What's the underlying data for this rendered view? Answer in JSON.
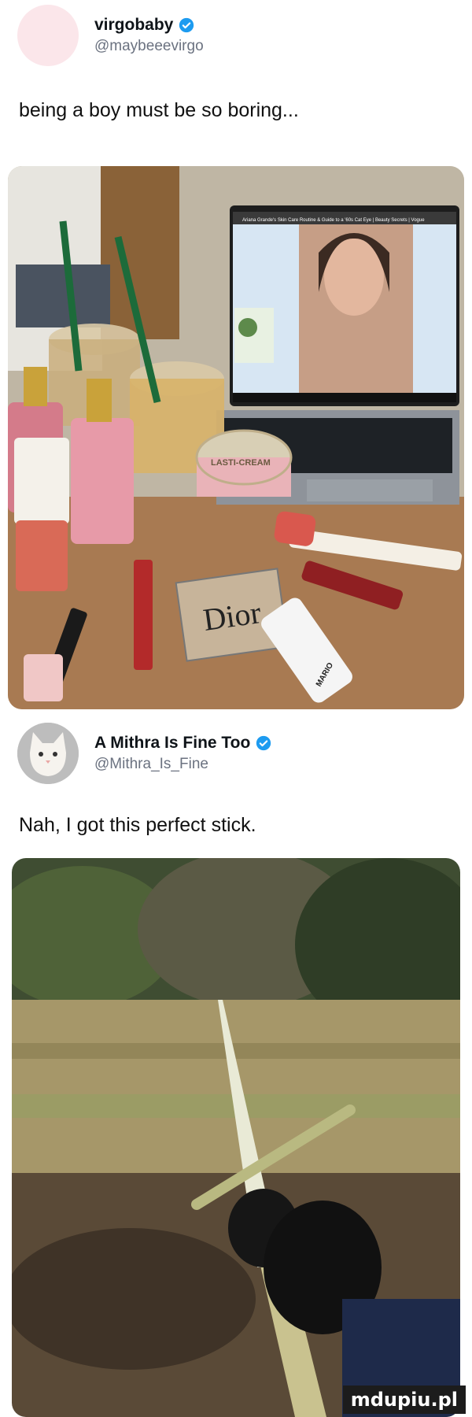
{
  "tweet1": {
    "name": "virgobaby",
    "handle": "@maybeeevirgo",
    "text": "being a boy must be so boring..."
  },
  "tweet1_media": {
    "video_title": "Ariana Grande's Skin Care Routine & Guide to a '60s Cat Eye | Beauty Secrets | Vogue",
    "jar_label": "LASTI-CREAM",
    "palette_label": "Dior",
    "tube_label": "MARIO"
  },
  "tweet2": {
    "name": "A Mithra Is Fine Too",
    "handle": "@Mithra_Is_Fine",
    "text": "Nah, I got this perfect stick."
  },
  "watermark": "mdupiu.pl",
  "colors": {
    "verified": "#1d9bf0",
    "handle": "#6b7280"
  }
}
